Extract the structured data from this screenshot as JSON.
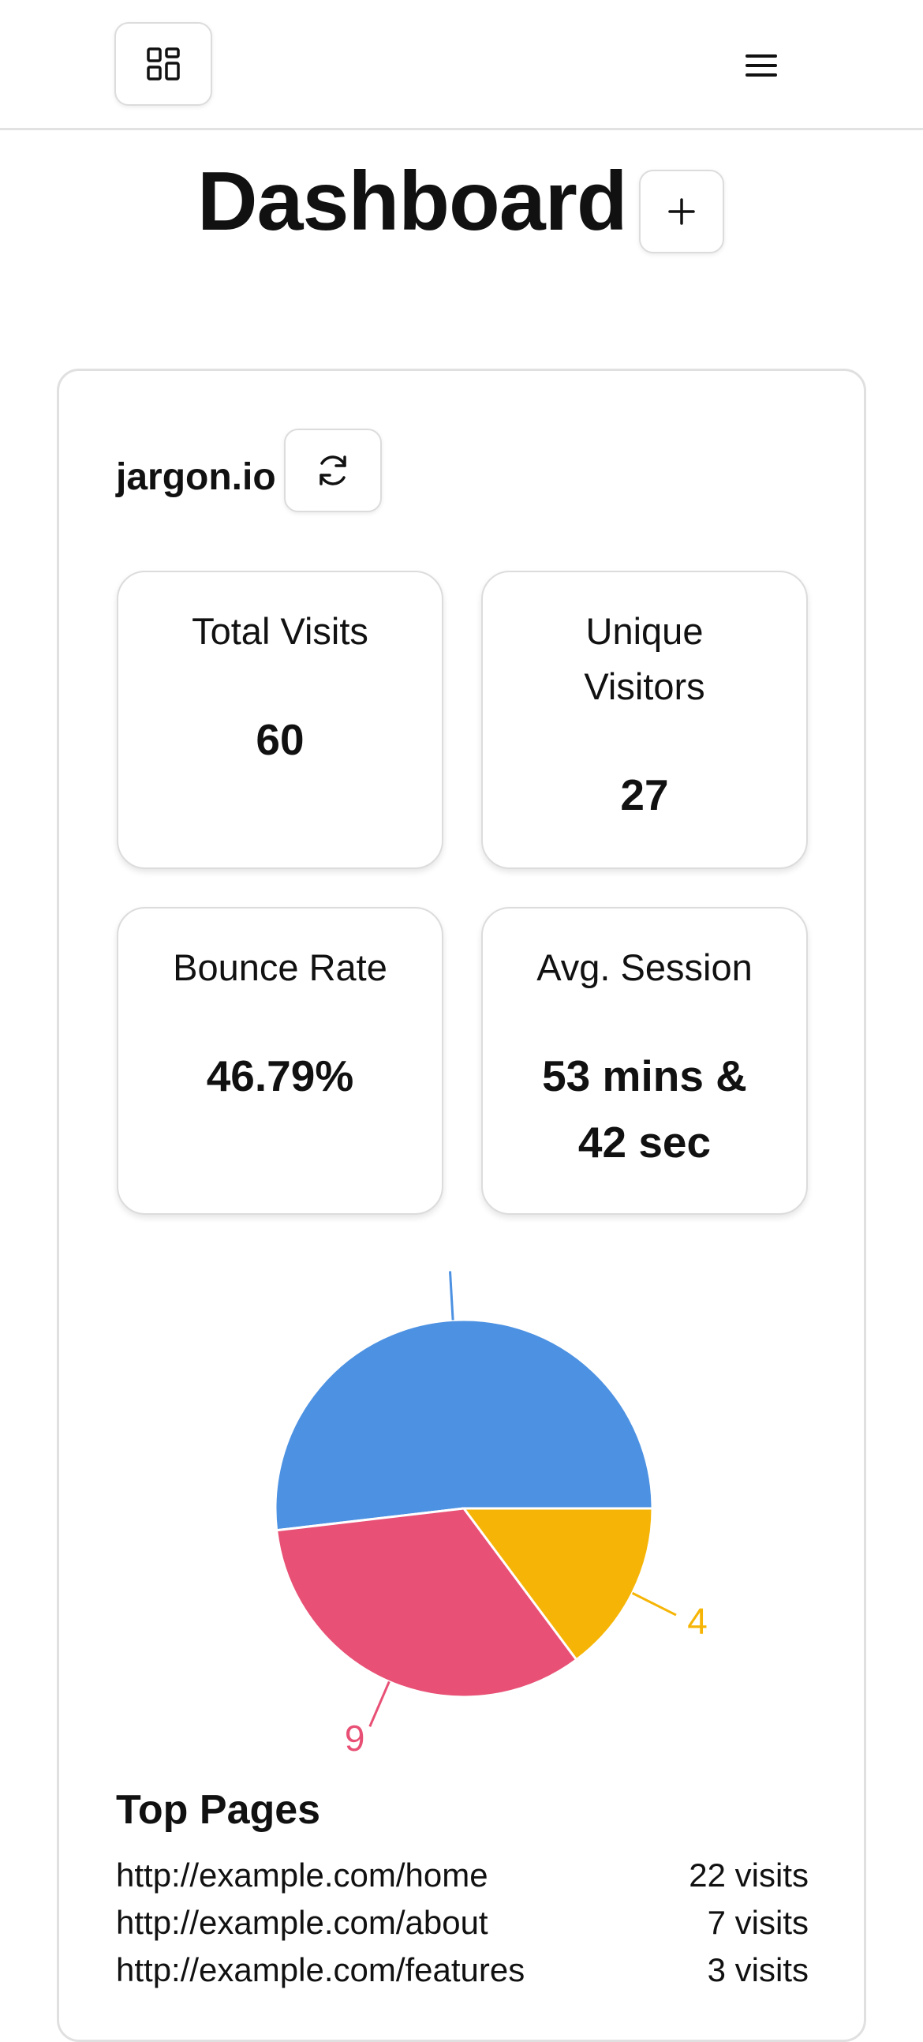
{
  "header": {
    "grid_icon": "grid-icon",
    "menu_icon": "hamburger-menu-icon"
  },
  "title": "Dashboard",
  "add_icon": "plus-icon",
  "site": {
    "name": "jargon.io",
    "refresh_icon": "refresh-icon"
  },
  "stats": [
    {
      "label": "Total Visits",
      "value": "60"
    },
    {
      "label": "Unique Visitors",
      "value": "27"
    },
    {
      "label": "Bounce Rate",
      "value": "46.79%"
    },
    {
      "label": "Avg. Session",
      "value": "53 mins & 42 sec"
    }
  ],
  "chart_data": {
    "type": "pie",
    "slices": [
      {
        "value": 14,
        "color": "#4c91e2"
      },
      {
        "value": 9,
        "color": "#e85075"
      },
      {
        "value": 4,
        "color": "#f6b506"
      }
    ],
    "data_labels": [
      {
        "text": "",
        "color": "#4c91e2"
      },
      {
        "text": "9",
        "color": "#e85075"
      },
      {
        "text": "4",
        "color": "#f6b506"
      }
    ]
  },
  "top_pages": {
    "title": "Top Pages",
    "rows": [
      {
        "url": "http://example.com/home",
        "visits": "22 visits"
      },
      {
        "url": "http://example.com/about",
        "visits": "7 visits"
      },
      {
        "url": "http://example.com/features",
        "visits": "3 visits"
      }
    ]
  }
}
